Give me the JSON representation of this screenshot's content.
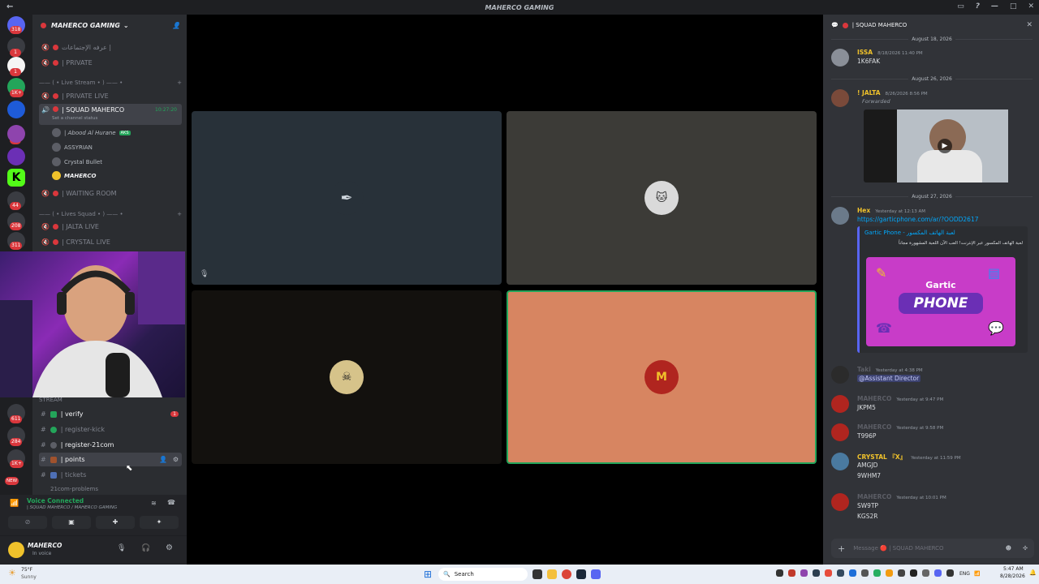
{
  "window": {
    "title": "MAHERCO GAMING"
  },
  "guilds": {
    "badges": [
      "318",
      "1",
      "1",
      "1K+",
      "1",
      "44",
      "208",
      "311",
      "611",
      "284",
      "1K+",
      "NEW"
    ]
  },
  "server": {
    "name": "MAHERCO GAMING",
    "channels": [
      {
        "name": "عرفه الإجتماعات |"
      },
      {
        "name": "| PRIVATE"
      },
      {
        "name": "| PRIVATE LIVE"
      },
      {
        "name": "| SQUAD MAHERCO",
        "time": "10:27:20",
        "status": "Set a channel status"
      },
      {
        "name": "| WAITING ROOM"
      },
      {
        "name": "| JALTA LIVE"
      },
      {
        "name": "| CRYSTAL LIVE"
      }
    ],
    "categories": [
      "—— ( • Live Stream • ) —— •",
      "—— ( • Lives Squad • ) —— •",
      "STREAM"
    ],
    "members": [
      {
        "name": "| Abood Al Hurane",
        "tag": "AKS"
      },
      {
        "name": "ASSYRIAN"
      },
      {
        "name": "Crystal Bullet"
      },
      {
        "name": "MAHERCO"
      }
    ],
    "text_channels": [
      "| verify",
      "| register-kick",
      "| register-21com",
      "| points",
      "| tickets",
      "21com-problems"
    ],
    "text_badge": "1"
  },
  "voice": {
    "status": "Voice Connected",
    "location": "| SQUAD MAHERCO / MAHERCO GAMING"
  },
  "user": {
    "name": "MAHERCO",
    "status": "In voice"
  },
  "chat": {
    "channel": "| SQUAD MAHERCO",
    "dates": [
      "August 18, 2026",
      "August 26, 2026",
      "August 27, 2026"
    ],
    "messages": [
      {
        "author": "ISSA",
        "time": "8/18/2026 11:40 PM",
        "text": "1K6FAK",
        "color": "#f0c22b"
      },
      {
        "author": "! JALTA",
        "time": "8/26/2026 8:56 PM",
        "text": "Forwarded",
        "color": "#f0c22b"
      },
      {
        "author": "Hex",
        "time": "Yesterday at 12:13 AM",
        "text": "https://garticphone.com/ar/?OODD2617",
        "color": "#f0c22b"
      },
      {
        "author": "Taki",
        "time": "Yesterday at 4:38 PM",
        "text": "@Assistant Director",
        "color": "#5c5e66"
      },
      {
        "author": "MAHERCO",
        "time": "Yesterday at 9:47 PM",
        "text": "JKPM5",
        "color": "#5c5e66"
      },
      {
        "author": "MAHERCO",
        "time": "Yesterday at 9:58 PM",
        "text": "T996P",
        "color": "#5c5e66"
      },
      {
        "author": "CRYSTAL 『X』",
        "time": "Yesterday at 11:59 PM",
        "text": "AMGJD",
        "text2": "9WHM7",
        "color": "#f0c22b"
      },
      {
        "author": "MAHERCO",
        "time": "Yesterday at 10:01 PM",
        "text": "SW9TP",
        "text2": "KGS2R",
        "color": "#5c5e66"
      }
    ],
    "embed": {
      "title": "Gartic Phone - لعبة الهاتف المكسور",
      "desc": "لعبة الهاتف المكسور عبر الإنترنت! العب الآن اللعبة المشهورة مجاناً",
      "logo_top": "Gartic",
      "logo_bottom": "PHONE"
    },
    "composer_placeholder": "Message 🔴 | SQUAD MAHERCO"
  },
  "taskbar": {
    "weather_temp": "75°F",
    "weather_text": "Sunny",
    "search": "Search",
    "lang": "ENG",
    "time": "5:47 AM",
    "date": "8/28/2026"
  },
  "colors": {
    "accent": "#5865f2",
    "danger": "#da373c",
    "tile1": "#283139",
    "tile2": "#3c3b37",
    "tile3": "#13110e",
    "tile4": "#d78561"
  }
}
